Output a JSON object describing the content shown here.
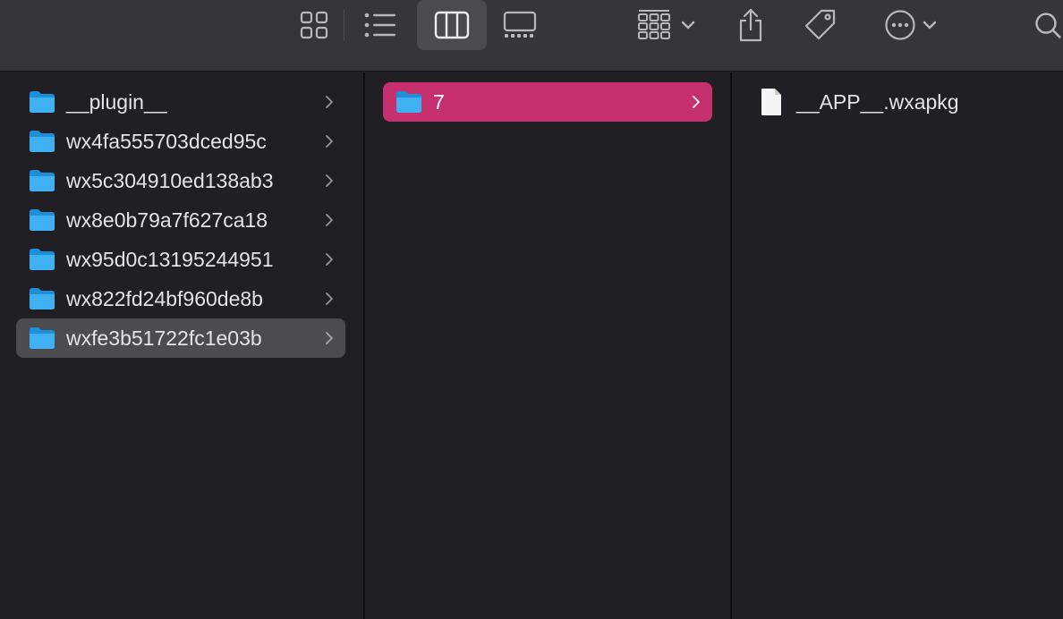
{
  "toolbar": {
    "view_modes": [
      "icon-view-icon",
      "list-view-icon",
      "column-view-icon",
      "gallery-view-icon"
    ],
    "active_view": "column-view-icon",
    "actions": [
      "group-icon",
      "share-icon",
      "tag-icon",
      "more-icon",
      "search-icon"
    ]
  },
  "columns": [
    {
      "items": [
        {
          "name": "__plugin__",
          "has_children": true
        },
        {
          "name": "wx4fa555703dced95c",
          "has_children": true
        },
        {
          "name": "wx5c304910ed138ab3",
          "has_children": true
        },
        {
          "name": "wx8e0b79a7f627ca18",
          "has_children": true
        },
        {
          "name": "wx95d0c13195244951",
          "has_children": true
        },
        {
          "name": "wx822fd24bf960de8b",
          "has_children": true
        },
        {
          "name": "wxfe3b51722fc1e03b",
          "has_children": true,
          "selected": true
        }
      ]
    },
    {
      "items": [
        {
          "name": "7",
          "has_children": true,
          "selected": true,
          "focused": true
        }
      ]
    },
    {
      "items": [
        {
          "name": "__APP__.wxapkg",
          "type": "file"
        }
      ]
    }
  ],
  "colors": {
    "toolbar_bg": "#35353a",
    "content_bg": "#1f1f24",
    "selection_inactive": "#4b4b50",
    "selection_active": "#c6306f",
    "folder_blue": "#3ba7ea"
  }
}
